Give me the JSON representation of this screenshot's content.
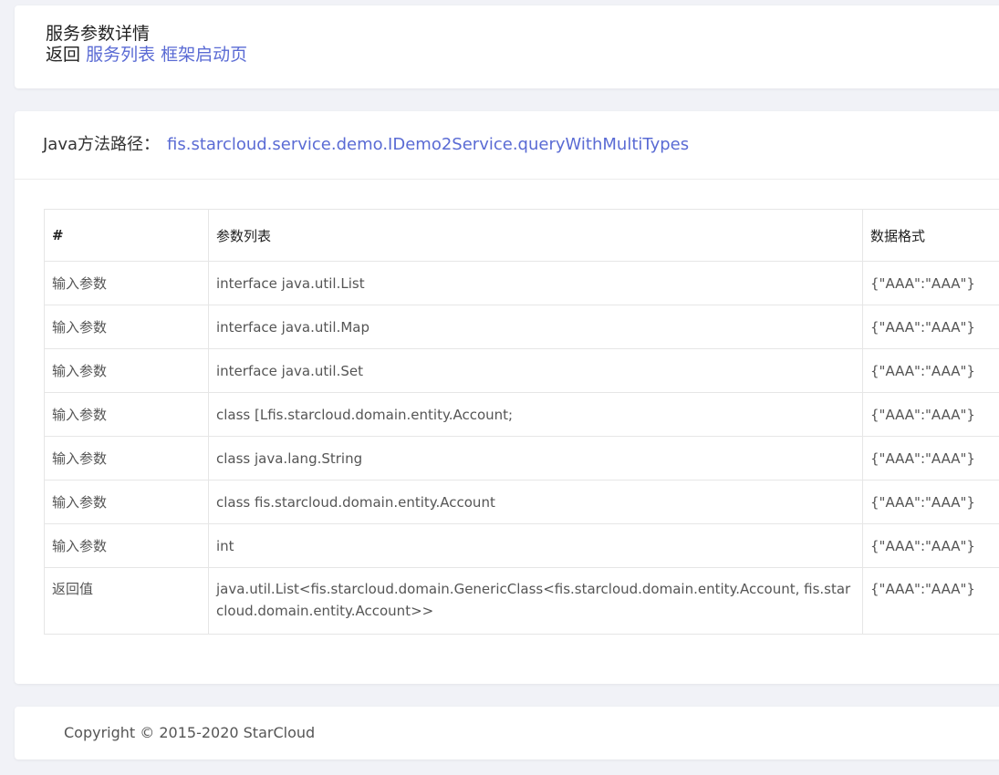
{
  "header": {
    "title": "服务参数详情",
    "back_label": "返回",
    "links": [
      {
        "label": "服务列表"
      },
      {
        "label": "框架启动页"
      }
    ]
  },
  "method": {
    "label": "Java方法路径：",
    "path": "fis.starcloud.service.demo.IDemo2Service.queryWithMultiTypes"
  },
  "table": {
    "headers": [
      "#",
      "参数列表",
      "数据格式"
    ],
    "rows": [
      {
        "kind": "输入参数",
        "type": "interface java.util.List",
        "format": "{\"AAA\":\"AAA\"}"
      },
      {
        "kind": "输入参数",
        "type": "interface java.util.Map",
        "format": "{\"AAA\":\"AAA\"}"
      },
      {
        "kind": "输入参数",
        "type": "interface java.util.Set",
        "format": "{\"AAA\":\"AAA\"}"
      },
      {
        "kind": "输入参数",
        "type": "class [Lfis.starcloud.domain.entity.Account;",
        "format": "{\"AAA\":\"AAA\"}"
      },
      {
        "kind": "输入参数",
        "type": "class java.lang.String",
        "format": "{\"AAA\":\"AAA\"}"
      },
      {
        "kind": "输入参数",
        "type": "class fis.starcloud.domain.entity.Account",
        "format": "{\"AAA\":\"AAA\"}"
      },
      {
        "kind": "输入参数",
        "type": "int",
        "format": "{\"AAA\":\"AAA\"}"
      },
      {
        "kind": "返回值",
        "type": "java.util.List<fis.starcloud.domain.GenericClass<fis.starcloud.domain.entity.Account, fis.starcloud.domain.entity.Account>>",
        "format": "{\"AAA\":\"AAA\"}"
      }
    ]
  },
  "footer": {
    "copyright": "Copyright © 2015-2020 StarCloud"
  },
  "colors": {
    "link": "#5a6bd4",
    "background": "#f1f2f7",
    "card": "#ffffff",
    "border": "#e6e6e6"
  }
}
